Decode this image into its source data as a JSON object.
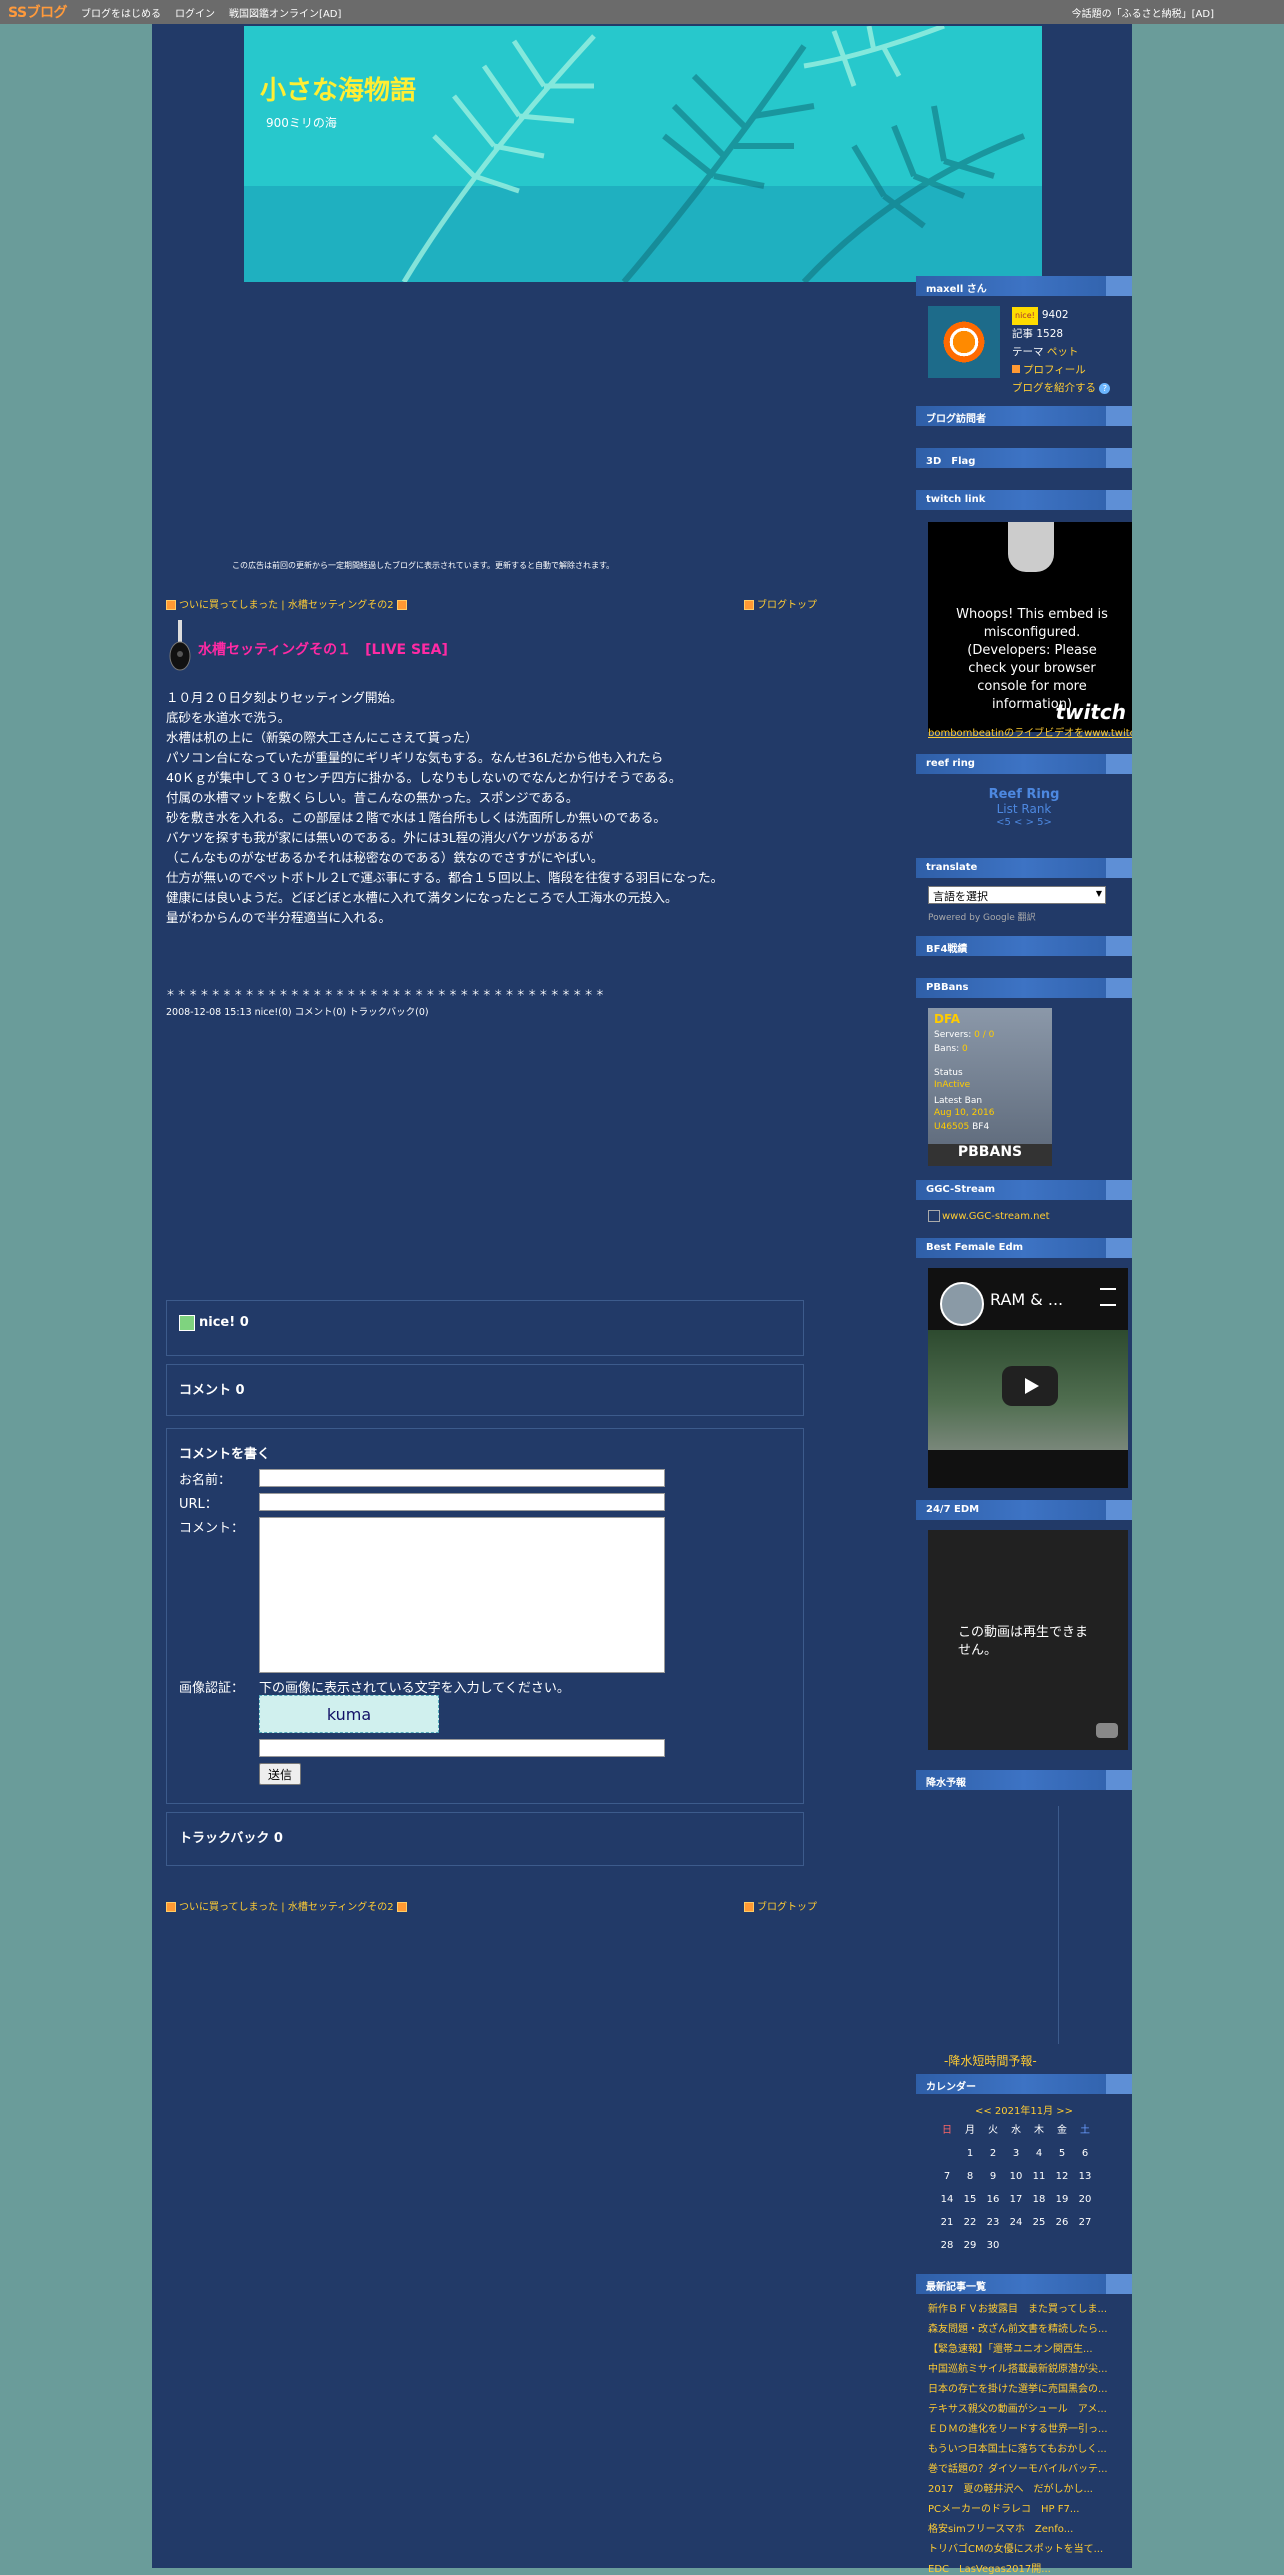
{
  "topbar": {
    "logo": "SSブログ",
    "links": [
      "ブログをはじめる",
      "ログイン",
      "戦国図鑑オンライン[AD]"
    ],
    "right": "今話題の「ふるさと納税」[AD]"
  },
  "site": {
    "title": "小さな海物語",
    "subtitle": "900ミリの海"
  },
  "ad_note": "この広告は前回の更新から一定期間経過したブログに表示されています。更新すると自動で解除されます。",
  "nav": {
    "prev_next": "ついに買ってしまった | 水槽セッティングその2",
    "top": "ブログトップ"
  },
  "article": {
    "title": "水槽セッティングその１　[LIVE SEA]",
    "lines": [
      "１０月２０日夕刻よりセッティング開始。",
      "底砂を水道水で洗う。",
      "水槽は机の上に（新築の際大工さんにこさえて貰った）",
      "パソコン台になっていたが重量的にギリギリな気もする。なんせ36Lだから他も入れたら",
      "40Ｋｇが集中して３０センチ四方に掛かる。しなりもしないのでなんとか行けそうである。",
      "付属の水槽マットを敷くらしい。昔こんなの無かった。スポンジである。",
      "砂を敷き水を入れる。この部屋は２階で水は１階台所もしくは洗面所しか無いのである。",
      "バケツを探すも我が家には無いのである。外には3L程の消火バケツがあるが",
      "（こんなものがなぜあるかそれは秘密なのである）鉄なのでさすがにやばい。",
      "仕方が無いのでペットボトル２Lで運ぶ事にする。都合１５回以上、階段を往復する羽目になった。",
      "健康には良いようだ。どぼどぼと水槽に入れて満タンになったところで人工海水の元投入。",
      "量がわからんので半分程適当に入れる。"
    ],
    "stars": "＊＊＊＊＊＊＊＊＊＊＊＊＊＊＊＊＊＊＊＊＊＊＊＊＊＊＊＊＊＊＊＊＊＊＊＊＊＊＊",
    "meta": "2008-12-08 15:13  nice!(0)  コメント(0)  トラックバック(0)"
  },
  "nice_box": "nice! 0",
  "comment_box": "コメント 0",
  "form": {
    "title": "コメントを書く",
    "name_label": "お名前：",
    "url_label": "URL：",
    "comment_label": "コメント：",
    "captcha_label": "画像認証：",
    "captcha_hint": "下の画像に表示されている文字を入力してください。",
    "captcha_text": "kuma",
    "submit": "送信"
  },
  "trackback_box": "トラックバック 0",
  "sidebar": {
    "user_header": "maxell さん",
    "nice_badge": "nice!",
    "nice_count": "9402",
    "articles": "記事 1528",
    "theme_label": "テーマ",
    "theme_value": "ペット",
    "profile_link": "プロフィール",
    "introduce_link": "ブログを紹介する",
    "visitors": "ブログ訪問者",
    "flag": "3D　Flag",
    "twitch_header": "twitch link",
    "twitch_msg": "Whoops! This embed is misconfigured. (Developers: Please check your browser console for more information)",
    "twitch_logo": "twitch",
    "twitch_link": "bombombeatinのライブビデオをwww.twitch.tv",
    "reefring_header": "reef ring",
    "reefring": [
      "Reef Ring",
      "List Rank",
      "<5 < > 5>"
    ],
    "translate_header": "translate",
    "translate_select": "言語を選択",
    "powered": "Powered by Google 翻訳",
    "bf4": "BF4戦績",
    "pbbans_header": "PBBans",
    "pbbans": {
      "name": "DFA",
      "servers_label": "Servers:",
      "servers": "0 / 0",
      "bans_label": "Bans:",
      "bans": "0",
      "status_label": "Status",
      "status": "InActive",
      "latest_label": "Latest Ban",
      "latest_date": "Aug 10, 2016",
      "latest_id": "U46505",
      "latest_game": "BF4",
      "logo": "PBBANS"
    },
    "ggc_header": "GGC-Stream",
    "ggc_text": "www.GGC-stream.net",
    "edm_header": "Best Female Edm",
    "yt_title": "RAM & ...",
    "edm247_header": "24/7 EDM",
    "yt2_msg": "この動画は再生できません。",
    "rain_header": "降水予報",
    "rain_label": "-降水短時間予報-",
    "calendar_header": "カレンダー",
    "calendar_nav": "<< 2021年11月 >>",
    "weekdays": [
      "日",
      "月",
      "火",
      "水",
      "木",
      "金",
      "土"
    ],
    "days": [
      "1",
      "2",
      "3",
      "4",
      "5",
      "6",
      "7",
      "8",
      "9",
      "10",
      "11",
      "12",
      "13",
      "14",
      "15",
      "16",
      "17",
      "18",
      "19",
      "20",
      "21",
      "22",
      "23",
      "24",
      "25",
      "26",
      "27",
      "28",
      "29",
      "30"
    ],
    "recent_header": "最新記事一覧",
    "recent": [
      "新作ＢＦＶお披露目　また買ってしま...",
      "森友問題・改ざん前文書を精読したら...",
      "【緊急速報】「還帯ユニオン関西生...",
      "中国巡航ミサイル搭載最新鋭原潜が尖...",
      "日本の存亡を掛けた選挙に売国黒会の...",
      "テキサス親父の動画がシュール　アメ...",
      "ＥＤＭの進化をリードする世界一引っ...",
      "もういつ日本国土に落ちてもおかしく...",
      "巻で話題の？ダイソーモバイルバッテ...",
      "2017　夏の軽井沢へ　だがしかし...",
      "PCメーカーのドラレコ　HP F7...",
      "格安simフリースマホ　Zenfo...",
      "トリバゴCMの女優にスポットを当て...",
      "EDC　LasVegas2017開..."
    ]
  }
}
